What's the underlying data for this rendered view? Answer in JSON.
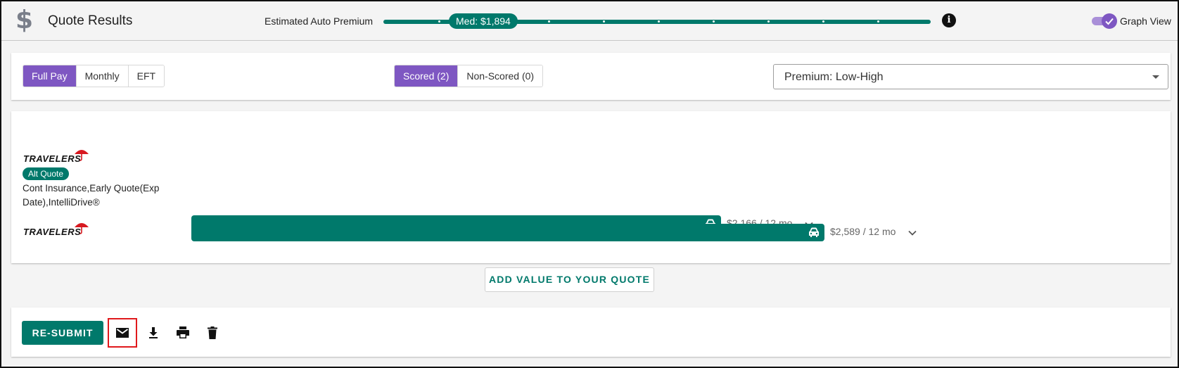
{
  "header": {
    "icon": "dollar-icon",
    "title": "Quote Results",
    "premium_label": "Estimated Auto Premium",
    "median_label": "Med: $1,894",
    "info_icon": "info-icon",
    "graph_view_label": "Graph View",
    "graph_view_on": true
  },
  "filters": {
    "pay_options": [
      "Full Pay",
      "Monthly",
      "EFT"
    ],
    "pay_active": "Full Pay",
    "score_options": [
      "Scored (2)",
      "Non-Scored (0)"
    ],
    "score_active": "Scored (2)",
    "sort_value": "Premium: Low-High"
  },
  "quotes": [
    {
      "carrier": "TRAVELERS",
      "badge": "Alt Quote",
      "description": "Cont Insurance,Early Quote(Exp Date),IntelliDrive®",
      "price": "$2,166 / 12 mo",
      "premium": 2166
    },
    {
      "carrier": "TRAVELERS",
      "badge": "",
      "description": "",
      "price": "$2,589 / 12 mo",
      "premium": 2589
    }
  ],
  "add_value_label": "ADD VALUE TO YOUR QUOTE",
  "actions": {
    "resubmit_label": "RE-SUBMIT",
    "icons": [
      "mail-icon",
      "download-icon",
      "print-icon",
      "delete-icon"
    ]
  },
  "colors": {
    "accent_green": "#00796b",
    "accent_purple": "#7e57c2",
    "highlight_red": "#e0191c"
  }
}
